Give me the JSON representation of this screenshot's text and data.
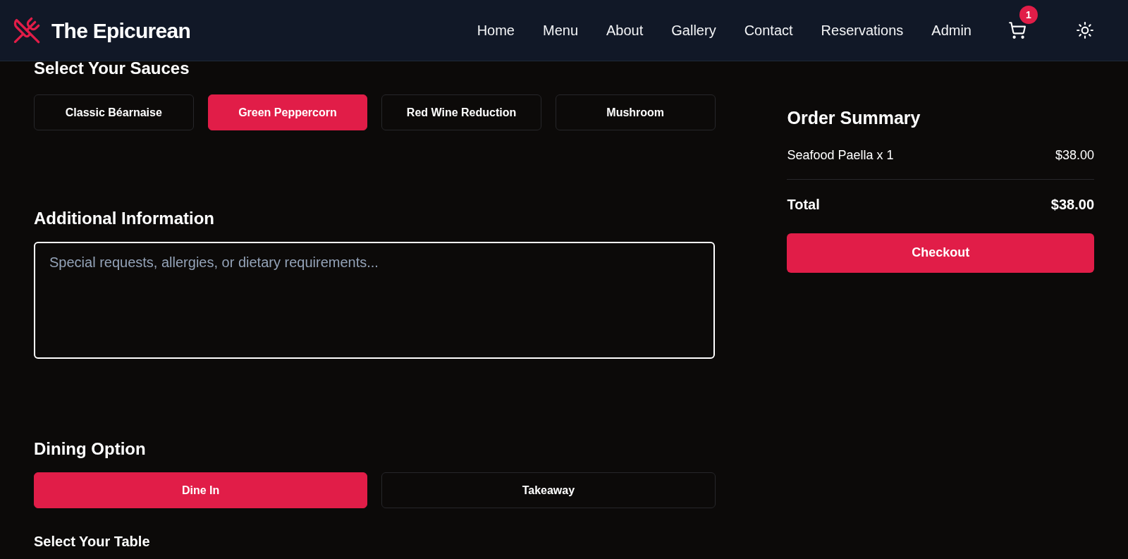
{
  "brand": {
    "name": "The Epicurean"
  },
  "nav": [
    {
      "label": "Home"
    },
    {
      "label": "Menu"
    },
    {
      "label": "About"
    },
    {
      "label": "Gallery"
    },
    {
      "label": "Contact"
    },
    {
      "label": "Reservations"
    },
    {
      "label": "Admin"
    }
  ],
  "cart": {
    "count": "1"
  },
  "sauces": {
    "title": "Select Your Sauces",
    "options": [
      {
        "label": "Classic Béarnaise",
        "selected": false
      },
      {
        "label": "Green Peppercorn",
        "selected": true
      },
      {
        "label": "Red Wine Reduction",
        "selected": false
      },
      {
        "label": "Mushroom",
        "selected": false
      }
    ]
  },
  "additional": {
    "title": "Additional Information",
    "placeholder": "Special requests, allergies, or dietary requirements..."
  },
  "dining": {
    "title": "Dining Option",
    "options": [
      {
        "label": "Dine In",
        "selected": true
      },
      {
        "label": "Takeaway",
        "selected": false
      }
    ],
    "table_title": "Select Your Table"
  },
  "summary": {
    "title": "Order Summary",
    "items": [
      {
        "name": "Seafood Paella x 1",
        "price": "$38.00"
      }
    ],
    "total_label": "Total",
    "total": "$38.00",
    "checkout": "Checkout"
  }
}
